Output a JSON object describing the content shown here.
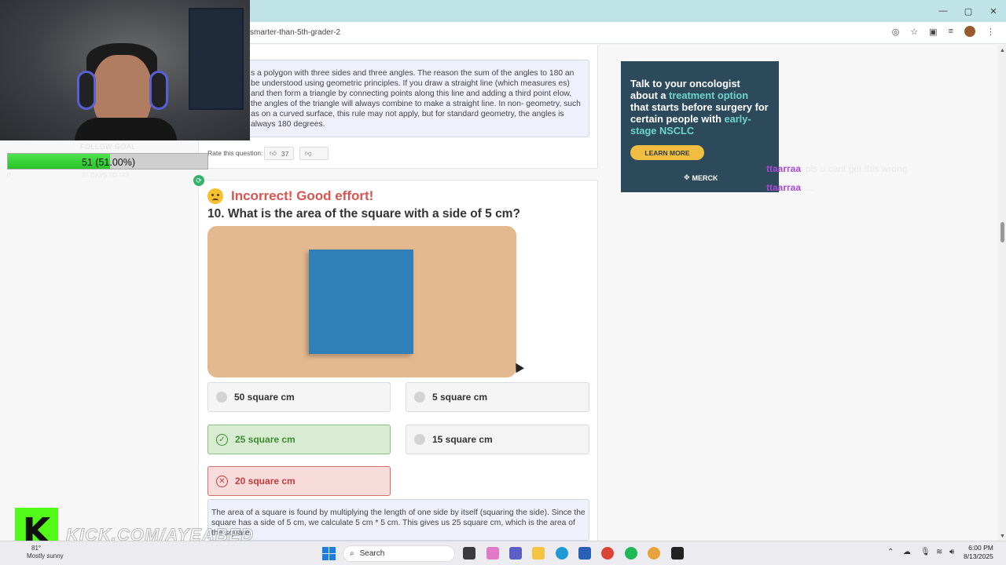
{
  "browser": {
    "url": "smarter-than-5th-grader-2",
    "window_controls": [
      "—",
      "▢",
      "✕"
    ]
  },
  "prev_question": {
    "explanation": "s a polygon with three sides and three angles. The reason the sum of the angles to 180 an be understood using geometric principles. If you draw a straight line (which measures es) and then form a triangle by connecting points along this line and adding a third point elow, the angles of the triangle will always combine to make a straight line. In non- geometry, such as on a curved surface, this rule may not apply, but for standard geometry, the angles is always 180 degrees.",
    "rate_label": "Rate this question:",
    "like_count": "37"
  },
  "question": {
    "result": "Incorrect! Good effort!",
    "text": "10. What is the area of the square with a side of 5 cm?",
    "options": [
      {
        "label": "50 square cm",
        "state": "neutral"
      },
      {
        "label": "5 square cm",
        "state": "neutral"
      },
      {
        "label": "25 square cm",
        "state": "correct"
      },
      {
        "label": "15 square cm",
        "state": "neutral"
      },
      {
        "label": "20 square cm",
        "state": "wrong"
      }
    ],
    "explanation": "The area of a square is found by multiplying the length of one side by itself (squaring the side). Since the square has a side of 5 cm, we calculate 5 cm * 5 cm. This gives us 25 square cm, which is the area of the square."
  },
  "ad": {
    "line1": "Talk to your oncologist about a ",
    "highlight1": "treatment option",
    "line2": " that starts before surgery for certain people with ",
    "highlight2": "early-stage NSCLC",
    "button": "LEARN MORE",
    "brand": "MERCK"
  },
  "chat": [
    {
      "user": "ttaarraa",
      "message": "pls u cant get this wrong"
    },
    {
      "user": "ttaarraa",
      "message": "..."
    }
  ],
  "stream": {
    "goal_label": "FOLLOW GOAL",
    "goal_text": "51 (51.00%)",
    "goal_fraction": 0.51,
    "goal_sub": "37 DAYS TO GO",
    "goal_zero": "0",
    "watermark": "KICK.COM/AYEABED"
  },
  "taskbar": {
    "weather_temp": "81°",
    "weather_desc": "Mostly sunny",
    "search_placeholder": "Search",
    "time": "6:00 PM",
    "date": "8/13/2025"
  },
  "colors": {
    "correct": "#3d8a33",
    "wrong": "#c43c3c",
    "ad_bg": "#2d4a5c",
    "ad_highlight": "#6fd4cf",
    "image_bg": "#e4b98f",
    "square": "#2f7fb8"
  }
}
